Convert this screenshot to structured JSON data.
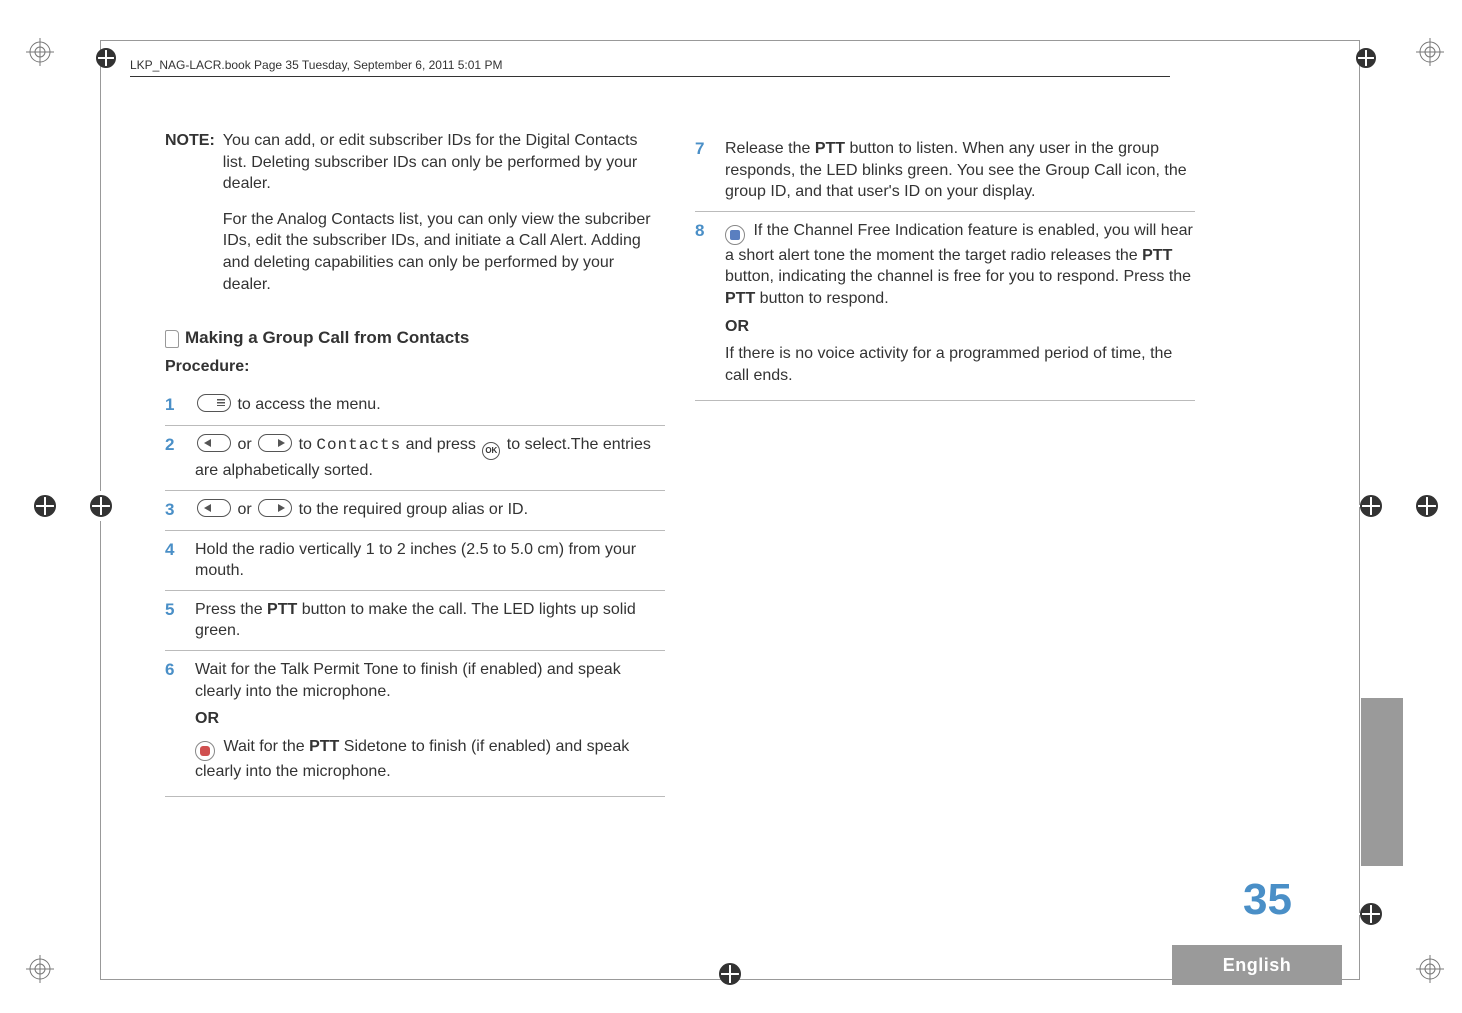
{
  "header": {
    "running_head": "LKP_NAG-LACR.book  Page 35  Tuesday, September 6, 2011  5:01 PM"
  },
  "left": {
    "note_label": "NOTE:",
    "note_p1": "You can add, or edit subscriber IDs for the Digital Contacts list. Deleting subscriber IDs can only be performed by your dealer.",
    "note_p2": "For the Analog Contacts list, you can only view the subcriber IDs, edit the subscriber IDs, and initiate a Call Alert. Adding and deleting capabilities can only be performed by your dealer.",
    "heading": "Making a Group Call from Contacts",
    "procedure_label": "Procedure:",
    "step1_after_icon": " to access the menu.",
    "step2_or": " or ",
    "step2_to": " to ",
    "step2_contacts": "Contacts",
    "step2_and_press": " and press ",
    "step2_ok": "OK",
    "step2_tail": " to select.The entries are alphabetically sorted.",
    "step3_or": " or ",
    "step3_tail": " to the required group alias or ID.",
    "step4": "Hold the radio vertically 1 to 2 inches (2.5 to 5.0 cm) from your mouth.",
    "step5_pre": "Press the ",
    "step5_ptt": "PTT",
    "step5_post": " button to make the call. The LED lights up solid green.",
    "step6_p1": "Wait for the Talk Permit Tone to finish (if enabled) and speak clearly into the microphone.",
    "step6_or": "OR",
    "step6_p2_pre": " Wait for the ",
    "step6_p2_ptt": "PTT",
    "step6_p2_post": " Sidetone to finish (if enabled) and speak clearly into the microphone."
  },
  "right": {
    "step7_pre": "Release the ",
    "step7_ptt": "PTT",
    "step7_post": " button to listen. When any user in the group responds, the LED blinks green. You see the Group Call icon, the group ID, and that user's ID on your display.",
    "step8_pre": " If the Channel Free Indication feature is enabled, you will hear a short alert tone the moment the target radio releases the ",
    "step8_ptt1": "PTT",
    "step8_mid": " button, indicating the channel is free for you to respond. Press the ",
    "step8_ptt2": "PTT",
    "step8_post": " button to respond.",
    "step8_or": "OR",
    "step8_tail": "If there is no voice activity for a programmed period of time, the call ends."
  },
  "footer": {
    "page_number": "35",
    "language": "English"
  }
}
